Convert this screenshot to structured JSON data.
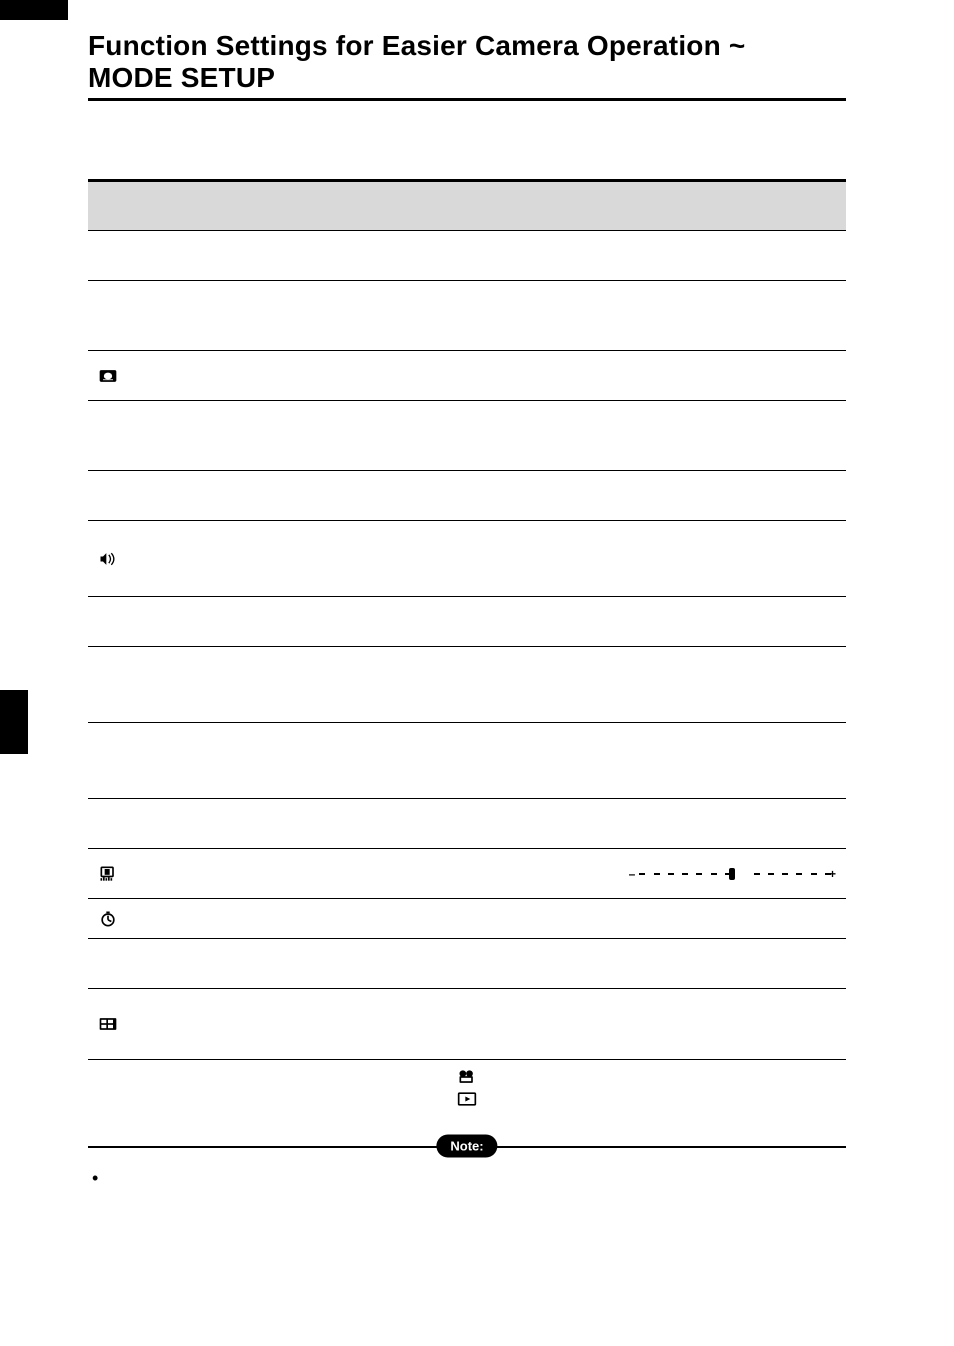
{
  "title_line1": "Function Settings for Easier Camera Operation ~",
  "title_line2": "MODE SETUP",
  "note_label": "Note:",
  "icons": {
    "recview": "recview-icon",
    "sound": "sound-icon",
    "lcd": "lcd-icon",
    "timer": "timer-icon",
    "fulltime": "fulltime-icon",
    "movie": "movie-icon",
    "play": "play-icon"
  },
  "table": {
    "rows": [
      {
        "height": "",
        "c1_icon": null,
        "c1": "",
        "c2": "",
        "c3": ""
      },
      {
        "height": "tall",
        "c1_icon": null,
        "c1": "",
        "c2": "",
        "c3": ""
      },
      {
        "height": "",
        "c1_icon": "recview",
        "c1": "",
        "c2": "",
        "c3": ""
      },
      {
        "height": "tall",
        "c1_icon": null,
        "c1": "",
        "c2": "",
        "c3": ""
      },
      {
        "height": "",
        "c1_icon": null,
        "c1": "",
        "c2": "",
        "c3": ""
      },
      {
        "height": "taller",
        "c1_icon": "sound",
        "c1": "",
        "c2": "",
        "c3": ""
      },
      {
        "height": "",
        "c1_icon": null,
        "c1": "",
        "c2": "",
        "c3": ""
      },
      {
        "height": "taller",
        "c1_icon": null,
        "c1": "",
        "c2": "",
        "c3": ""
      },
      {
        "height": "taller",
        "c1_icon": null,
        "c1": "",
        "c2": "",
        "c3": ""
      },
      {
        "height": "",
        "c1_icon": null,
        "c1": "",
        "c2": "",
        "c3": ""
      },
      {
        "height": "",
        "c1_icon": "lcd",
        "c1": "",
        "c2": "",
        "c3_special": "slider"
      },
      {
        "height": "short",
        "c1_icon": "timer",
        "c1": "",
        "c2": "",
        "c3": ""
      },
      {
        "height": "",
        "c1_icon": null,
        "c1": "",
        "c2": "",
        "c3": ""
      },
      {
        "height": "tall",
        "c1_icon": "fulltime",
        "c1": "",
        "c2": "",
        "c3": ""
      }
    ]
  },
  "footnote_line1_before": "",
  "footnote_line1_after": "",
  "footnote_line2_before": "",
  "footnote_line2_after": "",
  "bullet1": ""
}
